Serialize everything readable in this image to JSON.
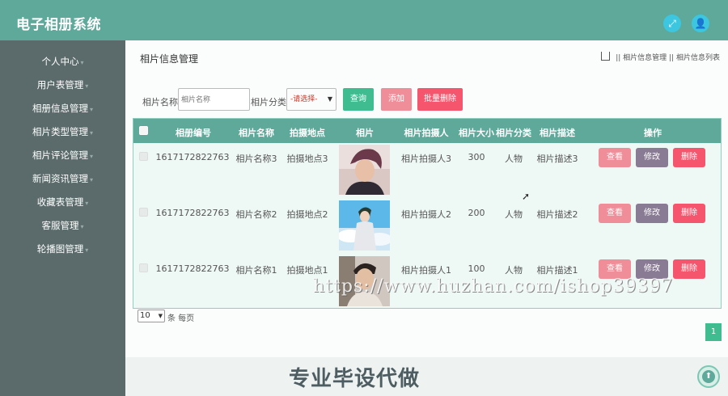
{
  "app": {
    "title": "电子相册系统"
  },
  "topbar": {
    "fullscreen_icon": "⤢",
    "user_icon": "👤"
  },
  "sidebar": {
    "items": [
      {
        "label": "个人中心"
      },
      {
        "label": "用户表管理"
      },
      {
        "label": "相册信息管理"
      },
      {
        "label": "相片类型管理"
      },
      {
        "label": "相片评论管理"
      },
      {
        "label": "新闻资讯管理"
      },
      {
        "label": "收藏表管理"
      },
      {
        "label": "客服管理"
      },
      {
        "label": "轮播图管理"
      }
    ]
  },
  "page": {
    "title": "相片信息管理",
    "breadcrumb": [
      "相片信息管理",
      "相片信息列表"
    ],
    "breadcrumb_sep": "||"
  },
  "search": {
    "name_label": "相片名称",
    "name_placeholder": "相片名称",
    "category_label": "相片分类",
    "category_selected": "-请选择-",
    "query_button": "查询",
    "add_button": "添加",
    "batch_delete_button": "批量删除"
  },
  "table": {
    "columns": [
      "相册编号",
      "相片名称",
      "拍摄地点",
      "相片",
      "相片拍摄人",
      "相片大小",
      "相片分类",
      "相片描述",
      "操作"
    ],
    "rows": [
      {
        "album_no": "1617172822763",
        "name": "相片名称3",
        "location": "拍摄地点3",
        "photographer": "相片拍摄人3",
        "size": "300",
        "category": "人物",
        "desc": "相片描述3"
      },
      {
        "album_no": "1617172822763",
        "name": "相片名称2",
        "location": "拍摄地点2",
        "photographer": "相片拍摄人2",
        "size": "200",
        "category": "人物",
        "desc": "相片描述2"
      },
      {
        "album_no": "1617172822763",
        "name": "相片名称1",
        "location": "拍摄地点1",
        "photographer": "相片拍摄人1",
        "size": "100",
        "category": "人物",
        "desc": "相片描述1"
      }
    ],
    "actions": {
      "view": "查看",
      "edit": "修改",
      "delete": "删除"
    }
  },
  "pagination": {
    "page_size": "10",
    "per_page_label": "条 每页",
    "current_page": "1"
  },
  "overlay": {
    "watermark": "https://www.huzhan.com/ishop39397",
    "banner": "专业毕设代做"
  },
  "colors": {
    "primary": "#5ea99a",
    "sidebar": "#5b6b6b",
    "query_btn": "#3fbd91",
    "add_btn": "#ef8d98",
    "delete_btn": "#f5566d",
    "view_btn": "#ef8d98",
    "edit_btn": "#8a7b94"
  }
}
